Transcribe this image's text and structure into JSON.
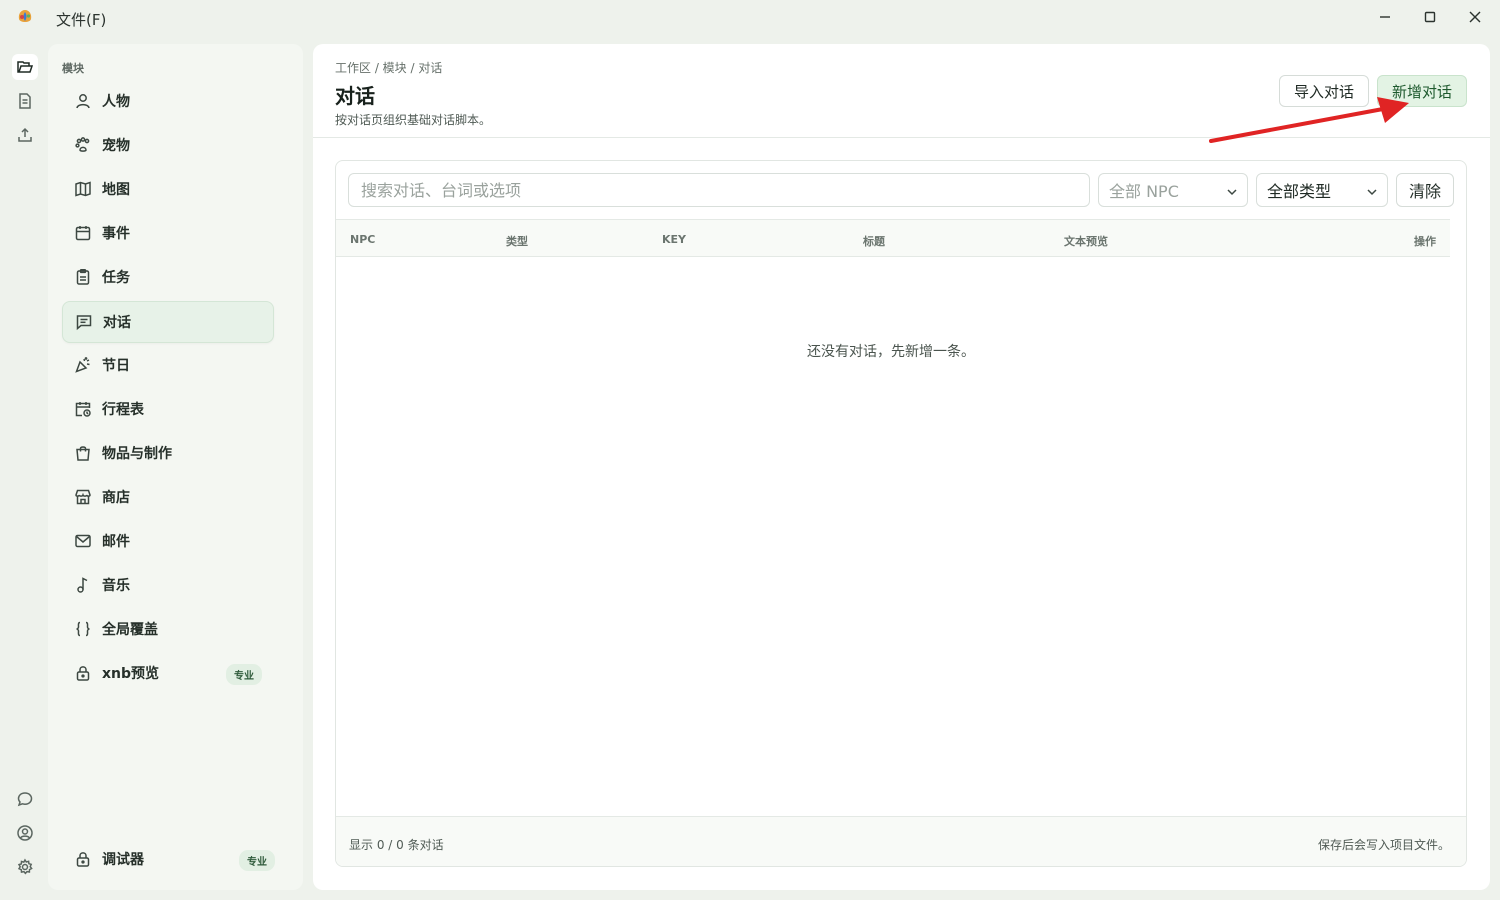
{
  "titlebar": {
    "menu_file": "文件(F)",
    "minimize_icon": "minimize-icon",
    "maximize_icon": "maximize-icon",
    "close_icon": "close-icon"
  },
  "rail": {
    "top": [
      "folder-open-icon",
      "document-icon",
      "upload-icon"
    ],
    "bottom": [
      "chat-icon",
      "user-circle-icon",
      "gear-icon"
    ]
  },
  "sidebar": {
    "heading": "模块",
    "items": [
      {
        "label": "人物",
        "icon": "person-icon"
      },
      {
        "label": "宠物",
        "icon": "paw-icon"
      },
      {
        "label": "地图",
        "icon": "map-icon"
      },
      {
        "label": "事件",
        "icon": "calendar-icon"
      },
      {
        "label": "任务",
        "icon": "clipboard-icon"
      },
      {
        "label": "对话",
        "icon": "message-square-icon",
        "active": true
      },
      {
        "label": "节日",
        "icon": "party-popper-icon"
      },
      {
        "label": "行程表",
        "icon": "calendar-clock-icon"
      },
      {
        "label": "物品与制作",
        "icon": "bag-icon"
      },
      {
        "label": "商店",
        "icon": "store-icon"
      },
      {
        "label": "邮件",
        "icon": "mail-icon"
      },
      {
        "label": "音乐",
        "icon": "music-note-icon"
      },
      {
        "label": "全局覆盖",
        "icon": "braces-icon"
      },
      {
        "label": "xnb预览",
        "icon": "lock-icon",
        "badge": "专业"
      }
    ],
    "debugger": {
      "label": "调试器",
      "icon": "lock-icon",
      "badge": "专业"
    }
  },
  "main": {
    "breadcrumb": "工作区 / 模块 / 对话",
    "title": "对话",
    "subtitle": "按对话页组织基础对话脚本。",
    "import_label": "导入对话",
    "new_label": "新增对话",
    "search_placeholder": "搜索对话、台词或选项",
    "npc_filter": "全部 NPC",
    "type_filter": "全部类型",
    "clear_label": "清除",
    "columns": [
      "NPC",
      "类型",
      "KEY",
      "标题",
      "文本预览",
      "操作"
    ],
    "empty_message": "还没有对话，先新增一条。",
    "footer_count": "显示 0 / 0 条对话",
    "footer_note": "保存后会写入项目文件。"
  },
  "colors": {
    "accent": "#1e5a2e",
    "accent_bg": "#e3f3e4",
    "annotation_arrow": "#e02424",
    "app_background": "#eef2ec"
  }
}
